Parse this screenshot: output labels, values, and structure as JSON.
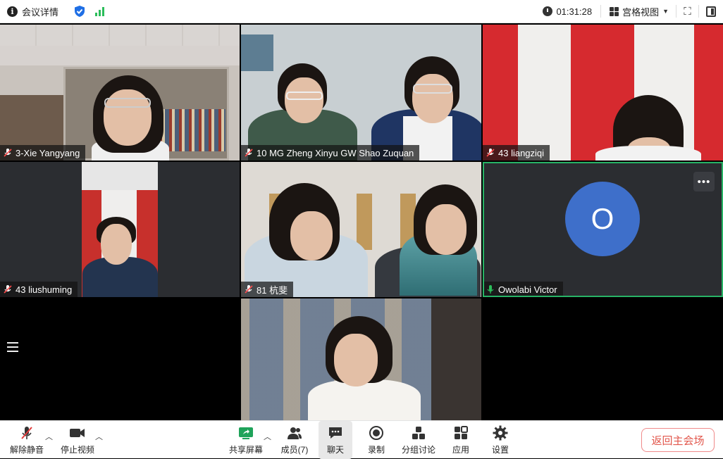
{
  "topbar": {
    "meeting_info": "会议详情",
    "timer": "01:31:28",
    "view_mode": "宫格视图"
  },
  "participants": [
    {
      "name": "3-Xie Yangyang",
      "muted": true
    },
    {
      "name": "10 MG Zheng Xinyu GW Shao Zuquan",
      "muted": true
    },
    {
      "name": "43 liangziqi",
      "muted": true
    },
    {
      "name": "43 liushuming",
      "muted": true
    },
    {
      "name": "81 杭斐",
      "muted": true
    },
    {
      "name": "Owolabi Victor",
      "muted": false,
      "avatar_letter": "O",
      "speaking": true
    }
  ],
  "toolbar": {
    "unmute": "解除静音",
    "stop_video": "停止视频",
    "share_screen": "共享屏幕",
    "members": "成员(7)",
    "chat": "聊天",
    "record": "录制",
    "breakout": "分组讨论",
    "apps": "应用",
    "settings": "设置",
    "return_main": "返回主会场"
  },
  "colors": {
    "accent_green": "#27b365",
    "avatar_blue": "#3e6fca",
    "return_red": "#e2574c"
  }
}
